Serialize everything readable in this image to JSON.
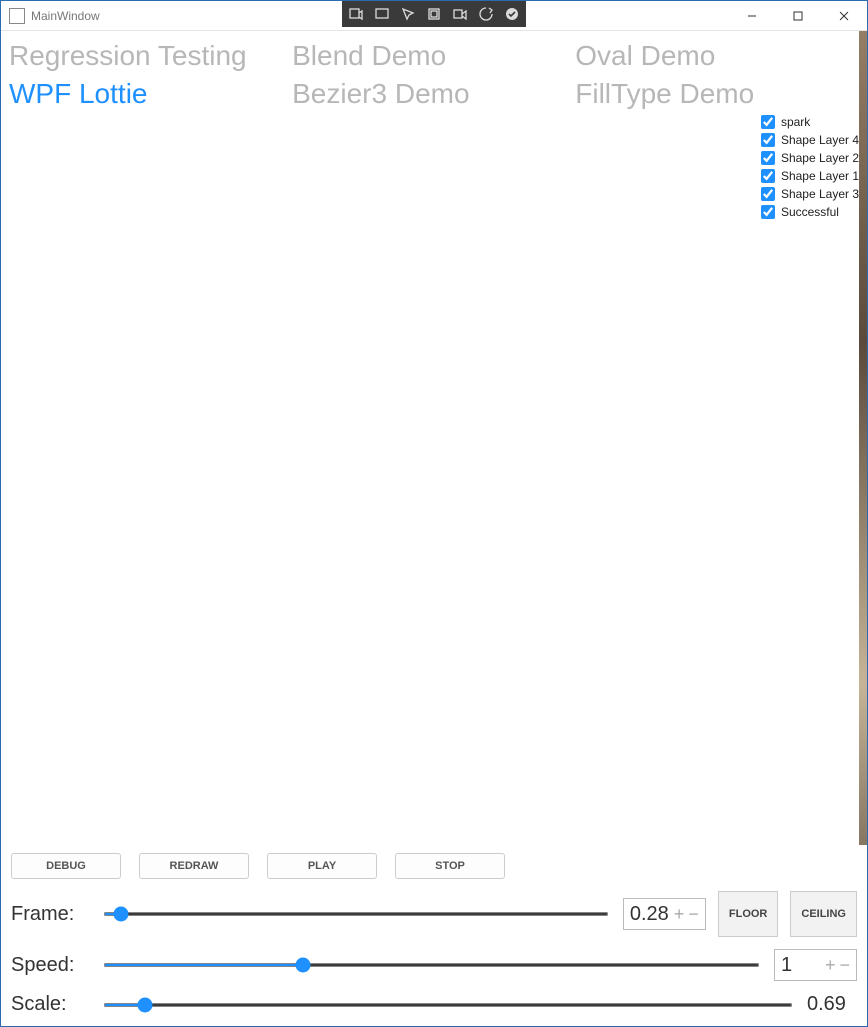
{
  "window": {
    "title": "MainWindow"
  },
  "tabs": [
    {
      "label": "Regression Testing",
      "active": false
    },
    {
      "label": "Blend Demo",
      "active": false
    },
    {
      "label": "Oval Demo",
      "active": false
    },
    {
      "label": "WPF Lottie",
      "active": true
    },
    {
      "label": "Bezier3 Demo",
      "active": false
    },
    {
      "label": "FillType Demo",
      "active": false
    }
  ],
  "layers": [
    {
      "label": "spark",
      "checked": true
    },
    {
      "label": "Shape Layer 4",
      "checked": true
    },
    {
      "label": "Shape Layer 2",
      "checked": true
    },
    {
      "label": "Shape Layer 1",
      "checked": true
    },
    {
      "label": "Shape Layer 3",
      "checked": true
    },
    {
      "label": "Successful",
      "checked": true
    }
  ],
  "buttons": {
    "debug": "DEBUG",
    "redraw": "REDRAW",
    "play": "PLAY",
    "stop": "STOP",
    "floor": "FLOOR",
    "ceiling": "CEILING"
  },
  "sliders": {
    "frame": {
      "label": "Frame:",
      "value": 0.28,
      "min": 0,
      "max": 100,
      "pos": 2
    },
    "speed": {
      "label": "Speed:",
      "value": 1,
      "min": 0,
      "max": 4,
      "pos": 30
    },
    "scale": {
      "label": "Scale:",
      "value": 0.69,
      "min": 0,
      "max": 4,
      "pos": 5
    }
  }
}
